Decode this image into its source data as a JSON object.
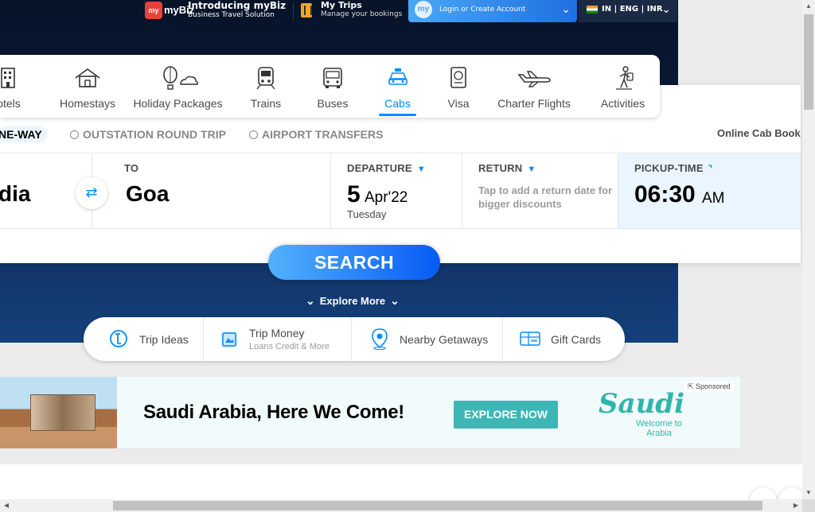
{
  "topbar": {
    "mybiz_logo": "myBiz",
    "intro_title": "Introducing myBiz",
    "intro_sub": "Business Travel Solution",
    "trips_title": "My Trips",
    "trips_sub": "Manage your bookings",
    "login_label": "Login or Create Account",
    "locale": "IN | ENG | INR"
  },
  "nav": [
    {
      "label": "otels",
      "icon": "hotel-icon"
    },
    {
      "label": "Homestays",
      "icon": "homestay-icon"
    },
    {
      "label": "Holiday Packages",
      "icon": "holiday-packages-icon"
    },
    {
      "label": "Trains",
      "icon": "train-icon"
    },
    {
      "label": "Buses",
      "icon": "bus-icon"
    },
    {
      "label": "Cabs",
      "icon": "cab-icon",
      "active": true
    },
    {
      "label": "Visa",
      "icon": "visa-icon"
    },
    {
      "label": "Charter Flights",
      "icon": "charter-flight-icon"
    },
    {
      "label": "Activities",
      "icon": "activities-icon"
    }
  ],
  "trip_types": {
    "one_way": "NE-WAY",
    "round_trip": "OUTSTATION ROUND TRIP",
    "airport": "AIRPORT TRANSFERS"
  },
  "online_cab": "Online Cab Book",
  "fields": {
    "from_value": "dia",
    "to_caption": "TO",
    "to_value": "Goa",
    "departure_caption": "DEPARTURE",
    "departure_day": "5",
    "departure_month": "Apr'22",
    "departure_weekday": "Tuesday",
    "return_caption": "RETURN",
    "return_hint": "Tap to add a return date for bigger discounts",
    "pickup_caption": "PICKUP-TIME",
    "pickup_time": "06:30",
    "pickup_ampm": "AM"
  },
  "search_label": "SEARCH",
  "explore_label": "Explore More",
  "quick_links": {
    "trip_ideas": "Trip Ideas",
    "trip_money": "Trip Money",
    "trip_money_sub": "Loans Credit & More",
    "nearby": "Nearby Getaways",
    "gift_cards": "Gift Cards"
  },
  "ad": {
    "headline": "Saudi Arabia, Here We Come!",
    "cta": "EXPLORE NOW",
    "logo_text": "Saudi",
    "logo_sub": "Welcome to Arabia",
    "sponsored": "Sponsored"
  },
  "colors": {
    "accent": "#008cff",
    "ad_button": "#3db7b6",
    "brand_dark": "#0a1a35"
  }
}
